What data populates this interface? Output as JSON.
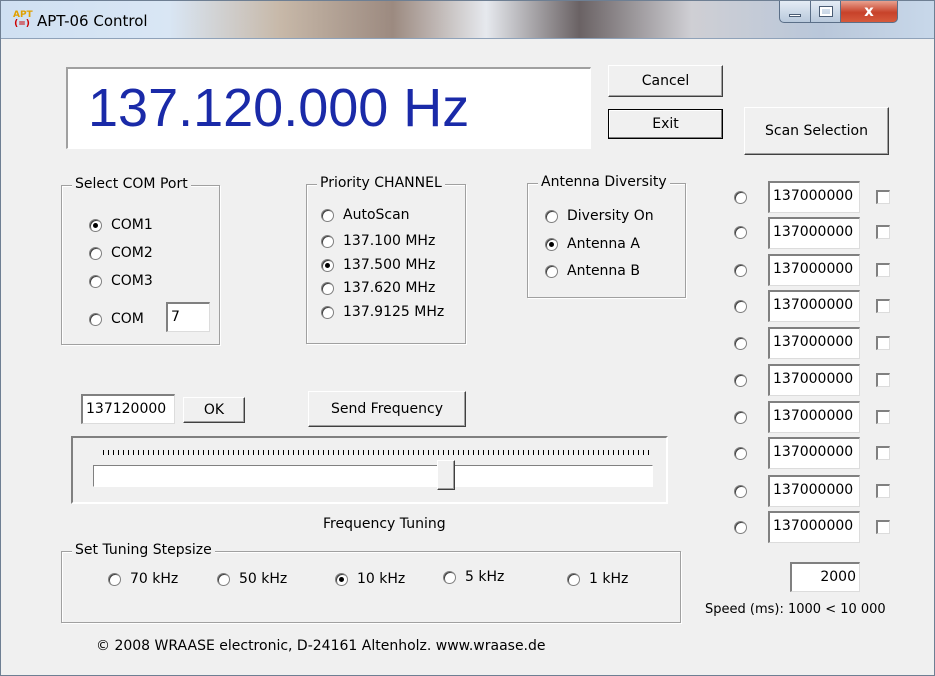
{
  "window": {
    "title": "APT-06 Control",
    "icon_text_top": "APT",
    "icon_text_bottom": "(=)",
    "close_glyph": "x"
  },
  "display": {
    "frequency_text": "137.120.000 Hz",
    "color": "#1a2aa8"
  },
  "buttons": {
    "cancel": "Cancel",
    "exit": "Exit",
    "scan_selection": "Scan Selection",
    "ok": "OK",
    "send_frequency": "Send Frequency"
  },
  "com_port": {
    "title": "Select COM Port",
    "options": [
      {
        "label": "COM1",
        "checked": true
      },
      {
        "label": "COM2",
        "checked": false
      },
      {
        "label": "COM3",
        "checked": false
      },
      {
        "label": "COM",
        "checked": false
      }
    ],
    "custom_value": "7"
  },
  "priority": {
    "title": "Priority CHANNEL",
    "options": [
      {
        "label": "AutoScan",
        "checked": false
      },
      {
        "label": "137.100  MHz",
        "checked": false
      },
      {
        "label": "137.500  MHz",
        "checked": true
      },
      {
        "label": "137.620  MHz",
        "checked": false
      },
      {
        "label": "137.9125 MHz",
        "checked": false
      }
    ]
  },
  "antenna": {
    "title": "Antenna Diversity",
    "options": [
      {
        "label": "Diversity On",
        "checked": false
      },
      {
        "label": "Antenna A",
        "checked": true
      },
      {
        "label": "Antenna B",
        "checked": false
      }
    ]
  },
  "frequency_input": "137120000",
  "tuning": {
    "label": "Frequency Tuning",
    "slider_fraction": 0.63
  },
  "stepsize": {
    "title": "Set Tuning Stepsize",
    "options": [
      {
        "label": "70 kHz",
        "checked": false
      },
      {
        "label": "50 kHz",
        "checked": false
      },
      {
        "label": "10 kHz",
        "checked": true
      },
      {
        "label": "5 kHz",
        "checked": false
      },
      {
        "label": "1 kHz",
        "checked": false
      }
    ]
  },
  "scan_list": [
    {
      "value": "137000000",
      "selected": false,
      "checked": false
    },
    {
      "value": "137000000",
      "selected": false,
      "checked": false
    },
    {
      "value": "137000000",
      "selected": false,
      "checked": false
    },
    {
      "value": "137000000",
      "selected": false,
      "checked": false
    },
    {
      "value": "137000000",
      "selected": false,
      "checked": false
    },
    {
      "value": "137000000",
      "selected": false,
      "checked": false
    },
    {
      "value": "137000000",
      "selected": false,
      "checked": false
    },
    {
      "value": "137000000",
      "selected": false,
      "checked": false
    },
    {
      "value": "137000000",
      "selected": false,
      "checked": false
    },
    {
      "value": "137000000",
      "selected": false,
      "checked": false
    }
  ],
  "speed": {
    "value": "2000",
    "label": "Speed (ms): 1000 < 10 000"
  },
  "footer": "© 2008   WRAASE electronic, D-24161 Altenholz. www.wraase.de"
}
